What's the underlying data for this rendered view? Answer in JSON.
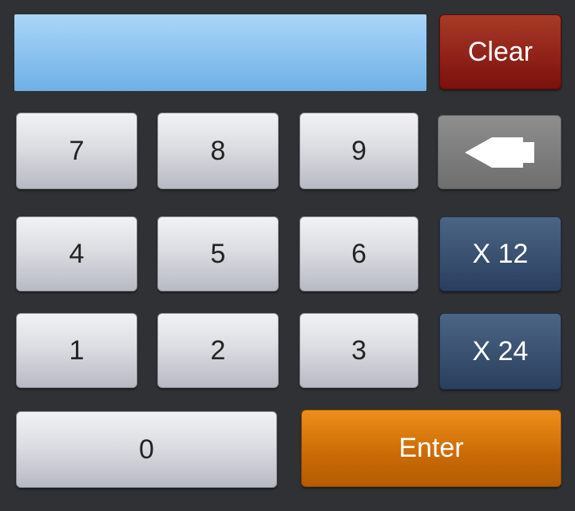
{
  "display": {
    "value": ""
  },
  "keys": {
    "clear": "Clear",
    "backspace_icon": "left-arrow-icon",
    "seven": "7",
    "eight": "8",
    "nine": "9",
    "four": "4",
    "five": "5",
    "six": "6",
    "one": "1",
    "two": "2",
    "three": "3",
    "zero": "0",
    "times12": "X 12",
    "times24": "X 24",
    "enter": "Enter"
  },
  "colors": {
    "background": "#2f3135",
    "display": "#8cc3ef",
    "clear": "#8f1f16",
    "backspace": "#7e7e7e",
    "multiplier": "#3a5272",
    "enter": "#d97a0c",
    "number_key": "#d6d7dc"
  }
}
